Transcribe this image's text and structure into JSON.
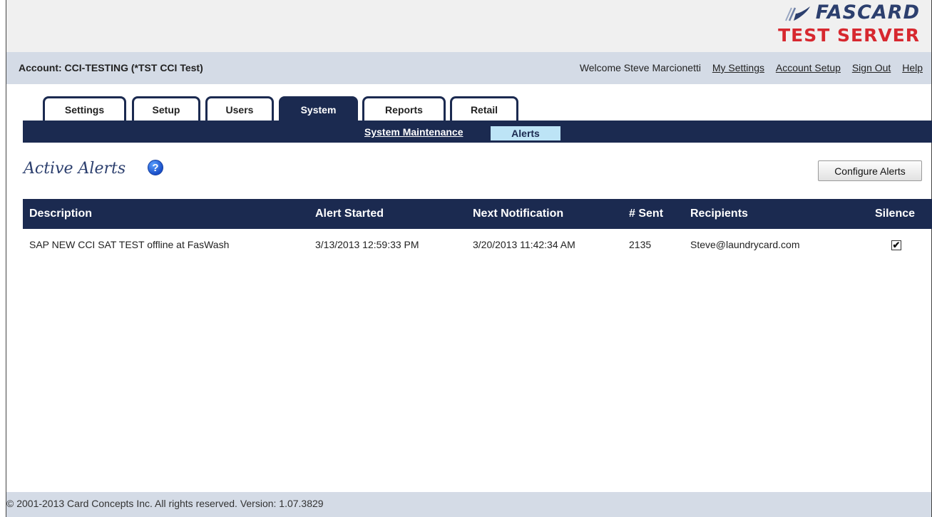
{
  "logo": {
    "brand": "FASCARD",
    "server_label": "TEST SERVER"
  },
  "account": {
    "label": "Account: CCI-TESTING (*TST CCI Test)"
  },
  "header_links": {
    "welcome": "Welcome Steve Marcionetti",
    "my_settings": "My Settings",
    "account_setup": "Account Setup",
    "sign_out": "Sign Out",
    "help": "Help"
  },
  "tabs": [
    {
      "label": "Settings",
      "active": false
    },
    {
      "label": "Setup",
      "active": false
    },
    {
      "label": "Users",
      "active": false
    },
    {
      "label": "System",
      "active": true
    },
    {
      "label": "Reports",
      "active": false
    },
    {
      "label": "Retail",
      "active": false
    }
  ],
  "subnav": {
    "system_maintenance": "System Maintenance",
    "alerts": "Alerts"
  },
  "page": {
    "title": "Active Alerts",
    "help_icon": "?",
    "configure_button": "Configure Alerts"
  },
  "table": {
    "headers": {
      "description": "Description",
      "alert_started": "Alert Started",
      "next_notification": "Next Notification",
      "sent": "# Sent",
      "recipients": "Recipients",
      "silence": "Silence"
    },
    "rows": [
      {
        "description": "SAP NEW CCI SAT TEST offline at FasWash",
        "alert_started": "3/13/2013 12:59:33 PM",
        "next_notification": "3/20/2013 11:42:34 AM",
        "sent": "2135",
        "recipients": "Steve@laundrycard.com",
        "silence_checked": true,
        "check_glyph": "✔"
      }
    ]
  },
  "footer": {
    "text": "© 2001-2013 Card Concepts Inc. All rights reserved. Version: 1.07.3829"
  },
  "colors": {
    "nav_dark": "#1b2a50",
    "accent_blue": "#bde4f6",
    "brand": "#2c3f6e",
    "server_red": "#d7282f"
  }
}
